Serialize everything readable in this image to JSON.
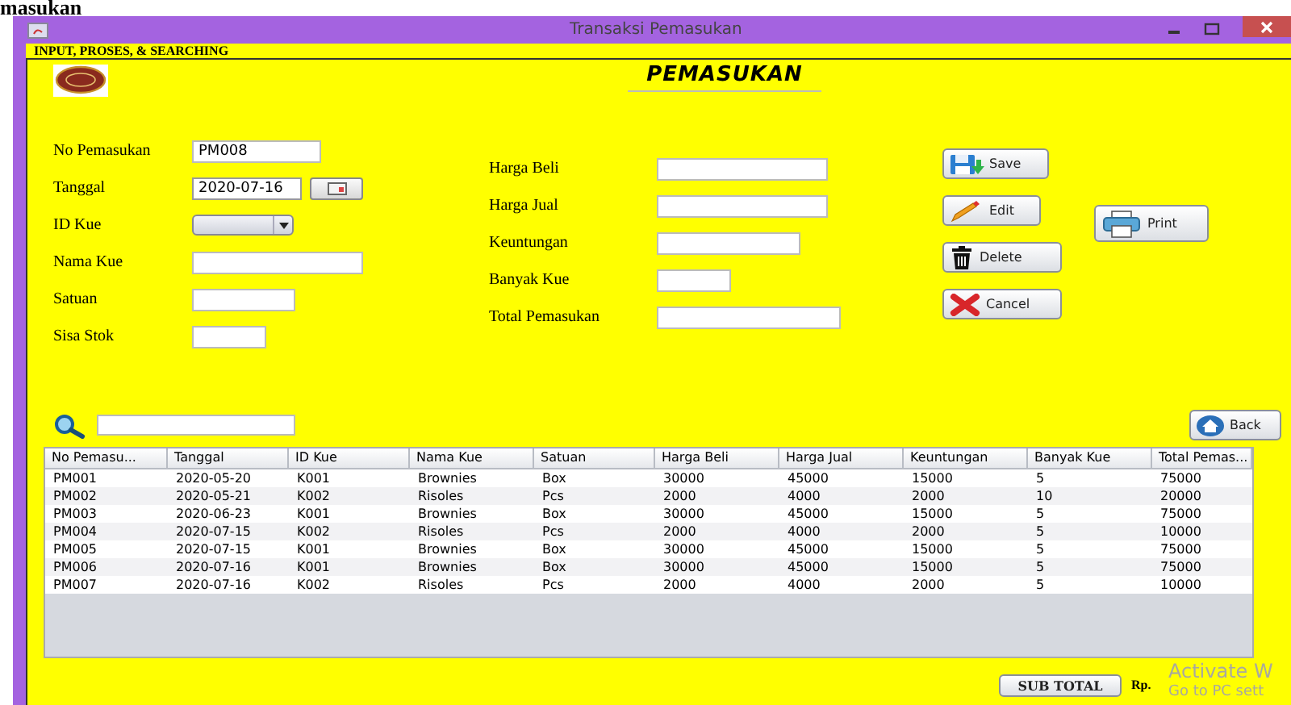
{
  "heading_fragment": "masukan",
  "window": {
    "title": "Transaksi Pemasukan"
  },
  "panel_title": "INPUT, PROSES, & SEARCHING",
  "form_title": "PEMASUKAN",
  "left_fields": [
    {
      "label": "No Pemasukan",
      "kind": "text",
      "value": "PM008"
    },
    {
      "label": "Tanggal",
      "kind": "date",
      "value": "2020-07-16"
    },
    {
      "label": "ID Kue",
      "kind": "combo"
    },
    {
      "label": "Nama Kue",
      "kind": "text"
    },
    {
      "label": "Satuan",
      "kind": "text"
    },
    {
      "label": "Sisa Stok",
      "kind": "text"
    }
  ],
  "right_fields": [
    {
      "label": "Harga Beli",
      "kind": "text"
    },
    {
      "label": "Harga Jual",
      "kind": "text"
    },
    {
      "label": "Keuntungan",
      "kind": "text"
    },
    {
      "label": "Banyak Kue",
      "kind": "text"
    },
    {
      "label": "Total Pemasukan",
      "kind": "text"
    }
  ],
  "buttons": [
    {
      "label": "Save",
      "kind": "save"
    },
    {
      "label": "Edit",
      "kind": "edit"
    },
    {
      "label": "Delete",
      "kind": "delete"
    },
    {
      "label": "Cancel",
      "kind": "cancel"
    }
  ],
  "print_button": {
    "label": "Print"
  },
  "back_button": {
    "label": "Back"
  },
  "table": {
    "columns": [
      "No Pemasu...",
      "Tanggal",
      "ID Kue",
      "Nama Kue",
      "Satuan",
      "Harga Beli",
      "Harga Jual",
      "Keuntungan",
      "Banyak Kue",
      "Total Pemas..."
    ],
    "rows": [
      [
        "PM001",
        "2020-05-20",
        "K001",
        "Brownies",
        "Box",
        "30000",
        "45000",
        "15000",
        "5",
        "75000"
      ],
      [
        "PM002",
        "2020-05-21",
        "K002",
        "Risoles",
        "Pcs",
        "2000",
        "4000",
        "2000",
        "10",
        "20000"
      ],
      [
        "PM003",
        "2020-06-23",
        "K001",
        "Brownies",
        "Box",
        "30000",
        "45000",
        "15000",
        "5",
        "75000"
      ],
      [
        "PM004",
        "2020-07-15",
        "K002",
        "Risoles",
        "Pcs",
        "2000",
        "4000",
        "2000",
        "5",
        "10000"
      ],
      [
        "PM005",
        "2020-07-15",
        "K001",
        "Brownies",
        "Box",
        "30000",
        "45000",
        "15000",
        "5",
        "75000"
      ],
      [
        "PM006",
        "2020-07-16",
        "K001",
        "Brownies",
        "Box",
        "30000",
        "45000",
        "15000",
        "5",
        "75000"
      ],
      [
        "PM007",
        "2020-07-16",
        "K002",
        "Risoles",
        "Pcs",
        "2000",
        "4000",
        "2000",
        "5",
        "10000"
      ]
    ]
  },
  "sub_total_button": {
    "label": "SUB TOTAL"
  },
  "currency": "Rp.",
  "os_overlay": [
    "Activate W",
    "Go to PC sett"
  ]
}
